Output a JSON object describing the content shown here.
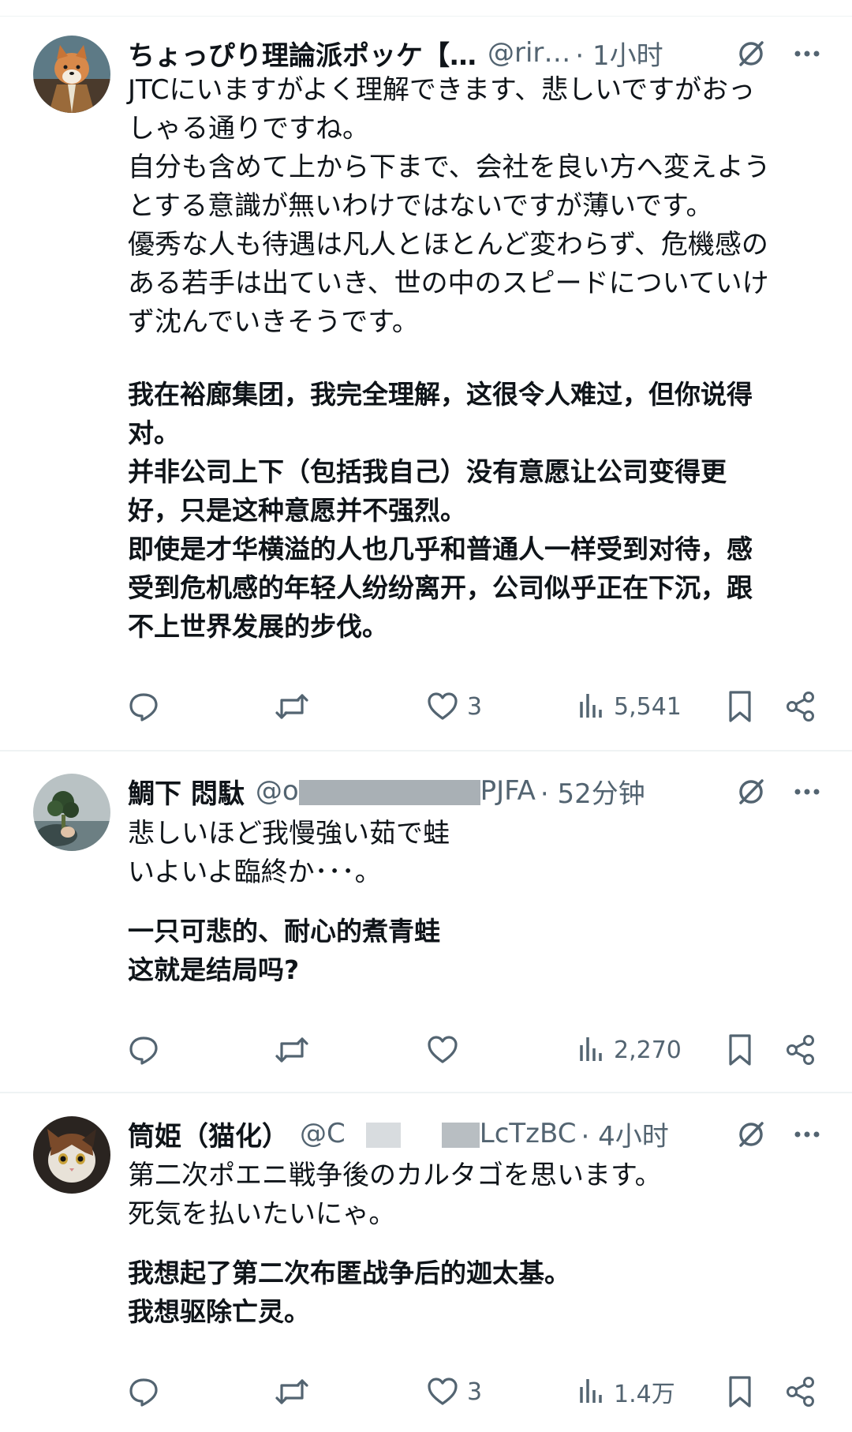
{
  "tweets": [
    {
      "name": "ちょっぴり理論派ポッケ【…",
      "handle": "@rir…",
      "time": "· 1小时",
      "jp": [
        "JTCにいますがよく理解できます、悲しいですがおっ",
        "しゃる通りですね。",
        "自分も含めて上から下まで、会社を良い方へ変えよう",
        "とする意識が無いわけではないですが薄いです。",
        "優秀な人も待遇は凡人とほとんど変わらず、危機感の",
        "ある若手は出ていき、世の中のスピードについていけ",
        "ず沈んでいきそうです。"
      ],
      "cn": [
        "我在裕廊集团，我完全理解，这很令人难过，但你说得",
        "对。",
        "并非公司上下（包括我自己）没有意愿让公司变得更",
        "好，只是这种意愿并不强烈。",
        "即使是才华横溢的人也几乎和普通人一样受到对待，感",
        "受到危机感的年轻人纷纷离开，公司似乎正在下沉，跟",
        "不上世界发展的步伐。"
      ],
      "likes": "3",
      "views": "5,541"
    },
    {
      "name": "鯛下 悶駄",
      "handle_a": "@o",
      "handle_b": "PJFA",
      "time": "· 52分钟",
      "jp": [
        "悲しいほど我慢強い茹で蛙",
        "いよいよ臨終か･･･。"
      ],
      "cn": [
        "一只可悲的、耐心的煮青蛙",
        "这就是结局吗?"
      ],
      "likes": "",
      "views": "2,270"
    },
    {
      "name": "筒姫（猫化）",
      "handle_a": "@C",
      "handle_b": "LcTzBC",
      "time": "· 4小时",
      "jp": [
        "第二次ポエニ戦争後のカルタゴを思います。",
        "死気を払いたいにゃ。"
      ],
      "cn": [
        "我想起了第二次布匿战争后的迦太基。",
        "我想驱除亡灵。"
      ],
      "likes": "3",
      "views": "1.4万"
    }
  ],
  "icons": [
    "grok-icon",
    "more-icon",
    "reply-icon",
    "retweet-icon",
    "like-icon",
    "views-icon",
    "bookmark-icon",
    "share-icon"
  ],
  "colors": {
    "text": "#0f1419",
    "secondary": "#536471",
    "divider": "#eff3f4"
  }
}
